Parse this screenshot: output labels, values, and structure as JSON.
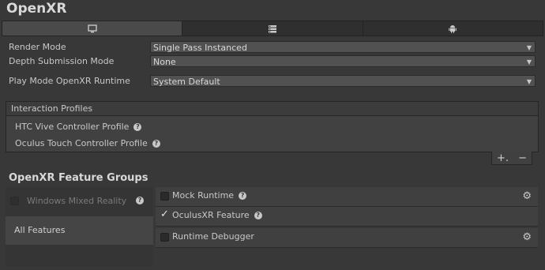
{
  "window": {
    "title": "OpenXR"
  },
  "tabs": [
    {
      "icon": "monitor-icon",
      "active": true
    },
    {
      "icon": "server-icon",
      "active": false
    },
    {
      "icon": "android-icon",
      "active": false
    }
  ],
  "settings": {
    "render_mode": {
      "label": "Render Mode",
      "value": "Single Pass Instanced"
    },
    "depth_submission": {
      "label": "Depth Submission Mode",
      "value": "None"
    },
    "play_mode_runtime": {
      "label": "Play Mode OpenXR Runtime",
      "value": "System Default"
    }
  },
  "interaction_profiles": {
    "header": "Interaction Profiles",
    "items": [
      "HTC Vive Controller Profile",
      "Oculus Touch Controller Profile"
    ],
    "add_label": "+.",
    "remove_label": "−"
  },
  "feature_groups": {
    "title": "OpenXR Feature Groups",
    "groups": [
      {
        "label": "Windows Mixed Reality",
        "checked": false,
        "disabled": true
      },
      {
        "label": "All Features",
        "selected": true
      }
    ]
  },
  "features": [
    {
      "label": "Mock Runtime",
      "checked": false,
      "has_help": true,
      "has_gear": true
    },
    {
      "label": "OculusXR Feature",
      "checked": true,
      "has_help": true,
      "has_gear": false
    },
    {
      "label": "Runtime Debugger",
      "checked": false,
      "has_help": false,
      "has_gear": true
    }
  ]
}
